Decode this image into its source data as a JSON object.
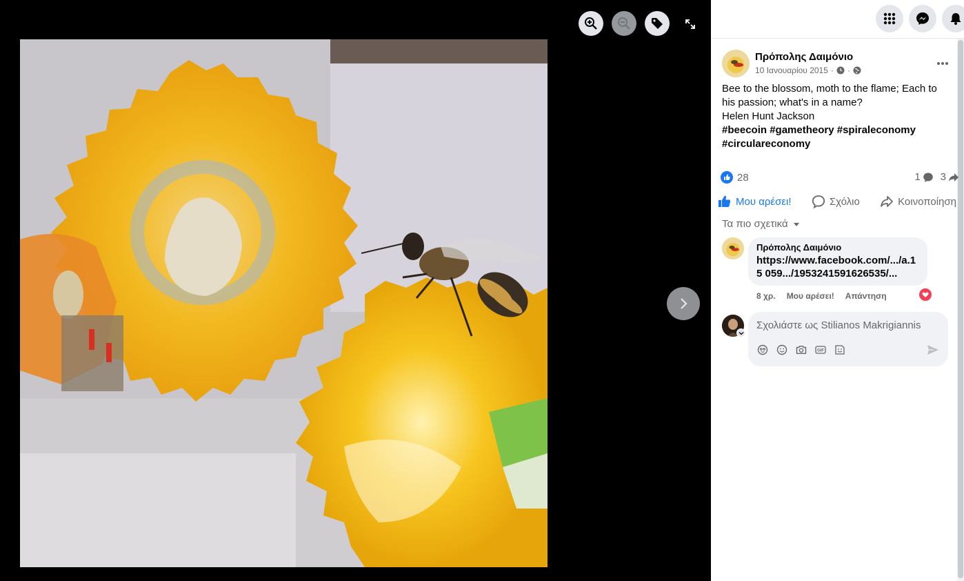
{
  "viewer": {
    "controls": [
      "zoom-in",
      "zoom-out",
      "tag",
      "fullscreen",
      "next"
    ],
    "photo_alt": ""
  },
  "topbar": {
    "icons": [
      "menu-grid-icon",
      "messenger-icon",
      "notifications-icon"
    ]
  },
  "post": {
    "author": "Πρόπολης Δαιμόνιο",
    "date": "10 Ιανουαρίου 2015",
    "separator": "·",
    "text_lines": [
      "Bee to the blossom, moth to the flame; Each to his passion; what's in a name?",
      "Helen Hunt Jackson"
    ],
    "hashtags": "#beecoin #gametheory #spiraleconomy #circulareconomy",
    "like_count": "28",
    "comment_count": "1",
    "share_count": "3"
  },
  "actions": {
    "like": "Μου αρέσει!",
    "comment": "Σχόλιο",
    "share": "Κοινοποίηση"
  },
  "comments": {
    "sort_label": "Τα πιο σχετικά",
    "items": [
      {
        "author": "Πρόπολης Δαιμόνιο",
        "text": "https://www.facebook.com/.../a.15 059.../1953241591626535/...",
        "age": "8 χρ.",
        "like_label": "Μου αρέσει!",
        "reply_label": "Απάντηση"
      }
    ],
    "composer_placeholder": "Σχολιάστε ως Stilianos Makrigiannis"
  },
  "colors": {
    "accent": "#1877f2",
    "heart": "#f33e58",
    "viewer_bg": "#000000"
  }
}
